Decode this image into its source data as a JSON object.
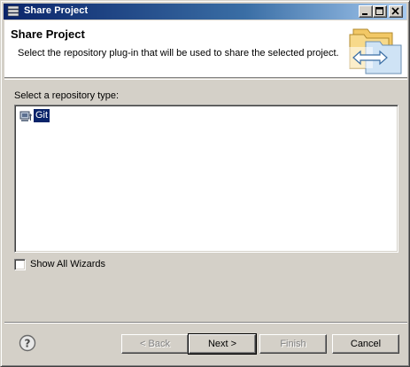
{
  "window": {
    "title": "Share Project"
  },
  "header": {
    "title": "Share Project",
    "description": "Select the repository plug-in that will be used to share the selected project."
  },
  "repository": {
    "label": "Select a repository type:",
    "items": [
      {
        "label": "Git",
        "selected": true,
        "icon": "git-repository-icon"
      }
    ]
  },
  "options": {
    "show_all_wizards_label": "Show All Wizards",
    "show_all_wizards_checked": false
  },
  "buttons": {
    "back": "< Back",
    "next": "Next >",
    "finish": "Finish",
    "cancel": "Cancel"
  },
  "colors": {
    "selection": "#0a246a",
    "titlebar_start": "#0a246a",
    "titlebar_end": "#a6caf0",
    "dialog_background": "#d4d0c8"
  }
}
